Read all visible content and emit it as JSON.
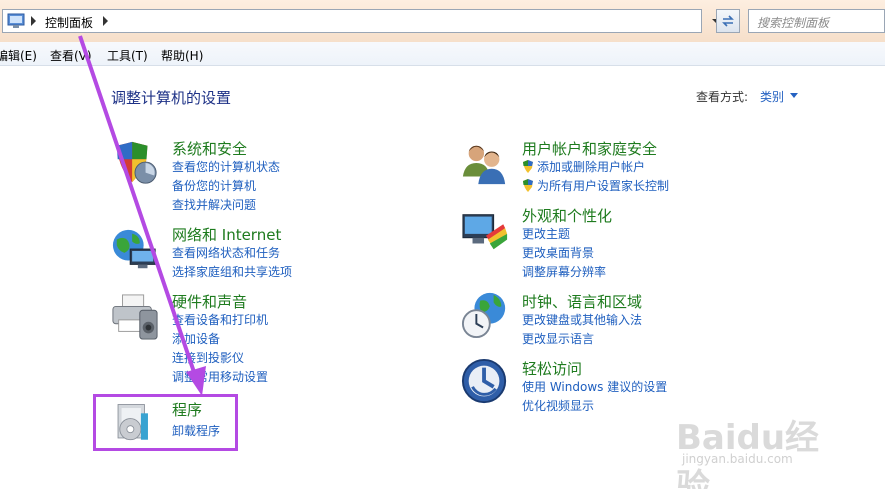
{
  "address_bar": {
    "path": "控制面板",
    "search_placeholder": "搜索控制面板"
  },
  "menu": [
    "编辑(E)",
    "查看(V)",
    "工具(T)",
    "帮助(H)"
  ],
  "page": {
    "title": "调整计算机的设置",
    "view_by_label": "查看方式:",
    "view_by_value": "类别"
  },
  "categories": {
    "system": {
      "title": "系统和安全",
      "links": [
        "查看您的计算机状态",
        "备份您的计算机",
        "查找并解决问题"
      ]
    },
    "network": {
      "title": "网络和 Internet",
      "links": [
        "查看网络状态和任务",
        "选择家庭组和共享选项"
      ]
    },
    "hardware": {
      "title": "硬件和声音",
      "links": [
        "查看设备和打印机",
        "添加设备",
        "连接到投影仪",
        "调整常用移动设置"
      ]
    },
    "programs": {
      "title": "程序",
      "links": [
        "卸载程序"
      ]
    },
    "users": {
      "title": "用户帐户和家庭安全",
      "links": [
        "添加或删除用户帐户",
        "为所有用户设置家长控制"
      ]
    },
    "appearance": {
      "title": "外观和个性化",
      "links": [
        "更改主题",
        "更改桌面背景",
        "调整屏幕分辨率"
      ]
    },
    "clock": {
      "title": "时钟、语言和区域",
      "links": [
        "更改键盘或其他输入法",
        "更改显示语言"
      ]
    },
    "ease": {
      "title": "轻松访问",
      "links": [
        "使用 Windows 建议的设置",
        "优化视频显示"
      ]
    }
  },
  "watermark": {
    "logo": "Baidu经验",
    "url": "jingyan.baidu.com"
  },
  "colors": {
    "category_title": "#1e7b1e",
    "link": "#1f5fbf",
    "highlight": "#b44ae3",
    "page_title": "#1e3287"
  }
}
